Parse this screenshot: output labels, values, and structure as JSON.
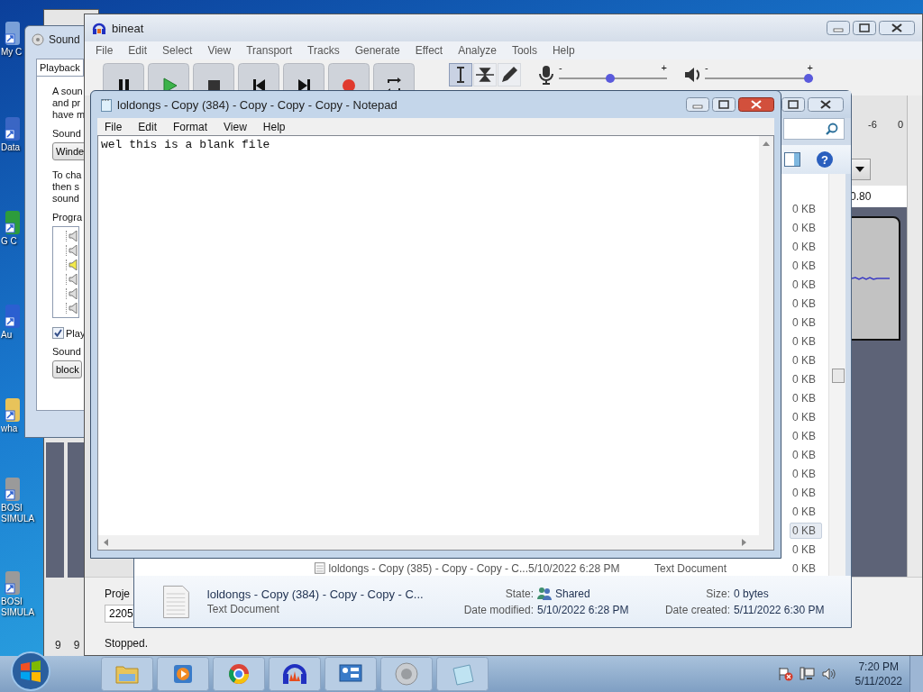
{
  "desktop_icons": [
    {
      "label": "My C"
    },
    {
      "label": "Data"
    },
    {
      "label": "G C"
    },
    {
      "label": "Au"
    },
    {
      "label": "wha"
    },
    {
      "label": "BOSI SIMULA"
    },
    {
      "label": "BOSI SIMULA"
    }
  ],
  "back_window": {
    "labels": [
      "9",
      "9"
    ]
  },
  "sound_window": {
    "title": "Sound",
    "tabs": [
      {
        "label": "Playback",
        "selected": true
      }
    ],
    "content": [
      {
        "kind": "text",
        "text": "A soun"
      },
      {
        "kind": "text",
        "text": "and pr"
      },
      {
        "kind": "text",
        "text": "have m"
      },
      {
        "kind": "label",
        "text": "Sound"
      },
      {
        "kind": "button",
        "text": "Winde"
      },
      {
        "kind": "text",
        "text": "To cha"
      },
      {
        "kind": "text",
        "text": "then s"
      },
      {
        "kind": "text",
        "text": "sound"
      },
      {
        "kind": "label",
        "text": "Progra"
      },
      {
        "kind": "tree"
      },
      {
        "kind": "checkbox",
        "text": "Play",
        "checked": true
      },
      {
        "kind": "label",
        "text": "Sound"
      },
      {
        "kind": "button",
        "text": "block"
      }
    ]
  },
  "audacity": {
    "title": "bineat",
    "menu": [
      "File",
      "Edit",
      "Select",
      "View",
      "Transport",
      "Tracks",
      "Generate",
      "Effect",
      "Analyze",
      "Tools",
      "Help"
    ],
    "tools": [
      {
        "selected": true
      },
      {
        "selected": false
      },
      {
        "selected": false
      }
    ],
    "record_slider": {
      "minus": "-",
      "plus": "+",
      "level": 0.47
    },
    "playback_slider": {
      "minus": "-",
      "plus": "+",
      "level": 1
    },
    "meter_ticks": [
      "-6",
      "0"
    ],
    "timeline_label": "0.80",
    "project_rate_label": "Proje",
    "project_rate_value": "2205",
    "status": "Stopped."
  },
  "explorer": {
    "sizes": [
      {
        "text": "0 KB",
        "selected": false
      },
      {
        "text": "0 KB",
        "selected": false
      },
      {
        "text": "0 KB",
        "selected": false
      },
      {
        "text": "0 KB",
        "selected": false
      },
      {
        "text": "0 KB",
        "selected": false
      },
      {
        "text": "0 KB",
        "selected": false
      },
      {
        "text": "0 KB",
        "selected": false
      },
      {
        "text": "0 KB",
        "selected": false
      },
      {
        "text": "0 KB",
        "selected": false
      },
      {
        "text": "0 KB",
        "selected": false
      },
      {
        "text": "0 KB",
        "selected": false
      },
      {
        "text": "0 KB",
        "selected": false
      },
      {
        "text": "0 KB",
        "selected": false
      },
      {
        "text": "0 KB",
        "selected": false
      },
      {
        "text": "0 KB",
        "selected": false
      },
      {
        "text": "0 KB",
        "selected": false
      },
      {
        "text": "0 KB",
        "selected": false
      },
      {
        "text": "0 KB",
        "selected": true
      },
      {
        "text": "0 KB",
        "selected": false
      },
      {
        "text": "0 KB",
        "selected": false
      }
    ],
    "last_row": {
      "name": "loldongs - Copy (385) - Copy - Copy - C...",
      "date": "5/10/2022 6:28 PM",
      "type": "Text Document"
    },
    "help_label": "?",
    "details": {
      "name": "loldongs - Copy (384) - Copy - Copy - C...",
      "type": "Text Document",
      "state_label": "State:",
      "state": "Shared",
      "modified_label": "Date modified:",
      "modified": "5/10/2022 6:28 PM",
      "size_label": "Size:",
      "size": "0 bytes",
      "created_label": "Date created:",
      "created": "5/11/2022 6:30 PM"
    }
  },
  "notepad": {
    "title": "loldongs - Copy (384) - Copy - Copy - Copy - Notepad",
    "menu": [
      "File",
      "Edit",
      "Format",
      "View",
      "Help"
    ],
    "text": "wel this is a blank file"
  },
  "taskbar": {
    "time": "7:20 PM",
    "date": "5/11/2022"
  }
}
